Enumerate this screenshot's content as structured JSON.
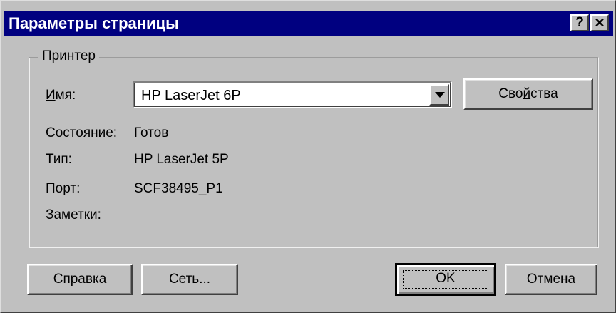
{
  "window": {
    "title": "Параметры страницы",
    "help_label": "?",
    "close_label": "✕"
  },
  "printer_group": {
    "legend": "Принтер",
    "name": {
      "label_accel": "И",
      "label_rest": "мя:",
      "value": "HP LaserJet 6P"
    },
    "properties_button": {
      "pre": "Сво",
      "accel": "й",
      "post": "ства"
    },
    "status": {
      "label": "Состояние:",
      "value": "Готов"
    },
    "type": {
      "label": "Тип:",
      "value": "HP LaserJet 5P"
    },
    "port": {
      "label": "Порт:",
      "value": "SCF38495_P1"
    },
    "notes": {
      "label": "Заметки:",
      "value": ""
    }
  },
  "buttons": {
    "help": {
      "accel": "С",
      "rest": "правка"
    },
    "network": {
      "pre": "С",
      "accel": "е",
      "post": "ть..."
    },
    "ok": "OK",
    "cancel": "Отмена"
  }
}
